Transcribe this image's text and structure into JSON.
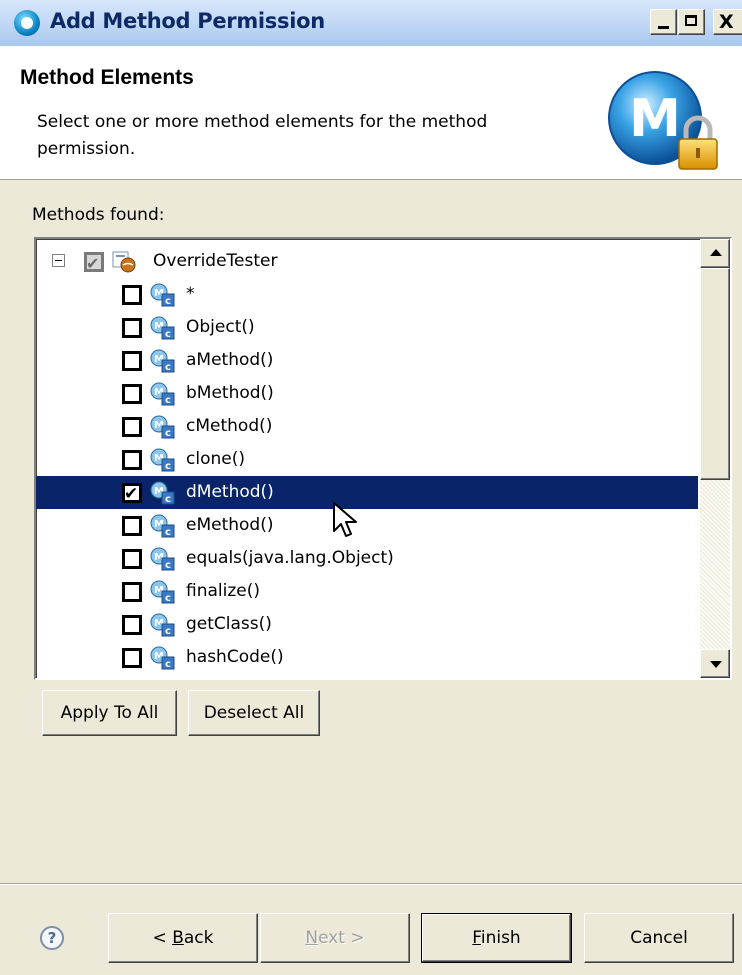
{
  "window": {
    "title": "Add Method Permission",
    "close_glyph": "X"
  },
  "banner": {
    "title": "Method Elements",
    "description": "Select one or more method elements for the method permission."
  },
  "methods_label": "Methods found:",
  "tree": {
    "root": {
      "label": "OverrideTester",
      "checked": true
    },
    "items": [
      {
        "label": "*",
        "checked": false
      },
      {
        "label": "Object()",
        "checked": false
      },
      {
        "label": "aMethod()",
        "checked": false
      },
      {
        "label": "bMethod()",
        "checked": false
      },
      {
        "label": "cMethod()",
        "checked": false
      },
      {
        "label": "clone()",
        "checked": false
      },
      {
        "label": "dMethod()",
        "checked": true,
        "selected": true
      },
      {
        "label": "eMethod()",
        "checked": false
      },
      {
        "label": "equals(java.lang.Object)",
        "checked": false
      },
      {
        "label": "finalize()",
        "checked": false
      },
      {
        "label": "getClass()",
        "checked": false
      },
      {
        "label": "hashCode()",
        "checked": false
      }
    ]
  },
  "actions": {
    "apply_to_all": "Apply To All",
    "deselect_all": "Deselect All"
  },
  "footer": {
    "help_glyph": "?",
    "back_prefix": "< ",
    "back_mnemonic": "B",
    "back_rest": "ack",
    "next_mnemonic": "N",
    "next_rest": "ext >",
    "finish_mnemonic": "F",
    "finish_rest": "inish",
    "cancel": "Cancel"
  },
  "colors": {
    "selection": "#0a246a",
    "dialog_bg": "#ece9d8",
    "title_text": "#0d2a66"
  }
}
